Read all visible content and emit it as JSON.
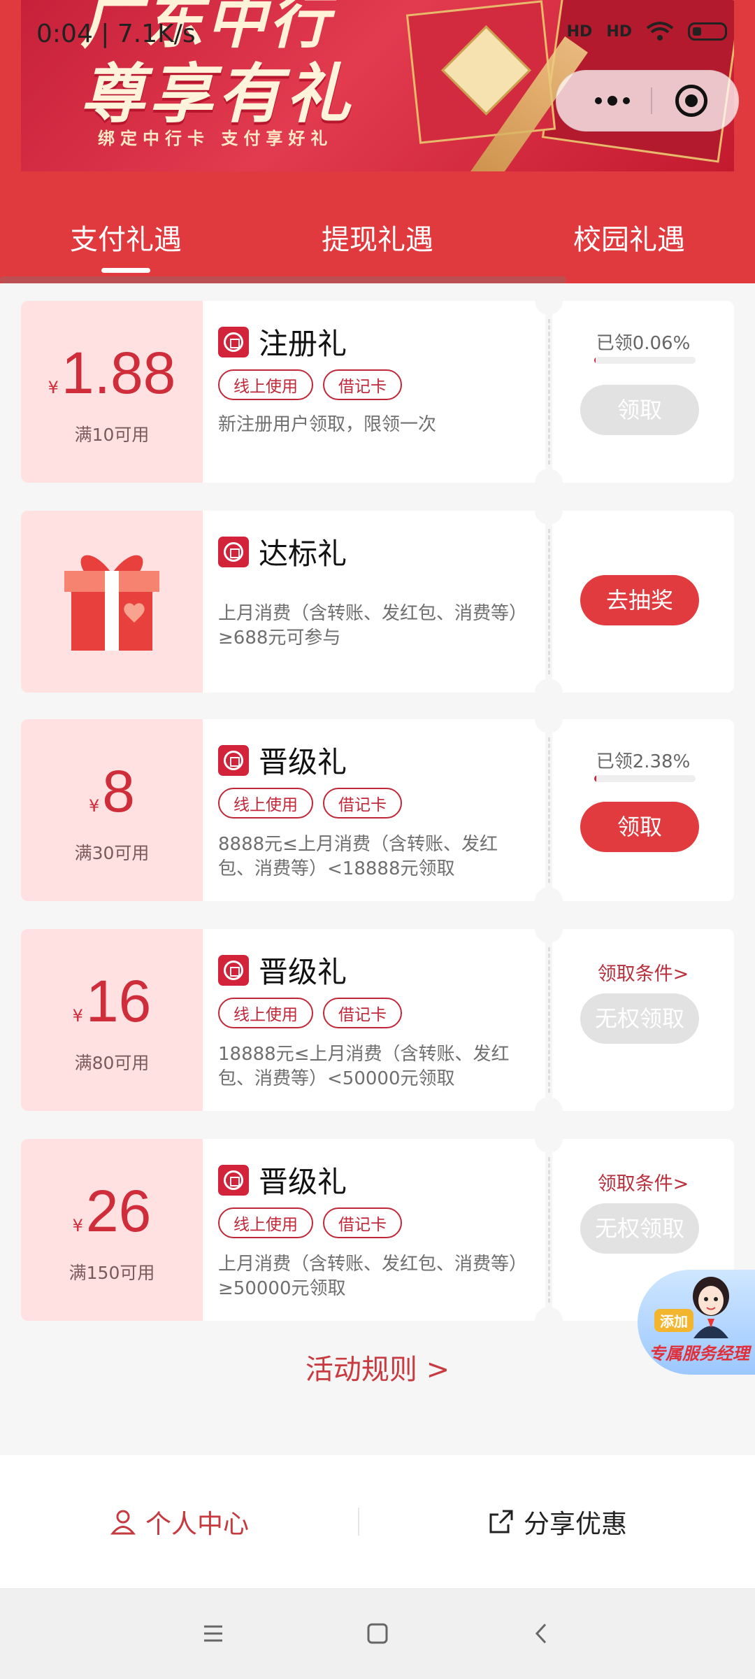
{
  "status_bar": {
    "time": "0:04 | 7.1K/s",
    "signal1": "HD",
    "signal2": "HD"
  },
  "banner": {
    "title_top": "广东中行",
    "title": "尊享有礼",
    "subtitle": "绑定中行卡  支付享好礼"
  },
  "tabs": [
    {
      "label": "支付礼遇",
      "active": true
    },
    {
      "label": "提现礼遇",
      "active": false
    },
    {
      "label": "校园礼遇",
      "active": false
    }
  ],
  "coupons": [
    {
      "currency": "¥",
      "amount": "1.88",
      "condition": "满10可用",
      "title": "注册礼",
      "tags": [
        "线上使用",
        "借记卡"
      ],
      "description": "新注册用户领取，限领一次",
      "claimed": "已领0.06%",
      "claimed_fraction": 0.0006,
      "button": "领取",
      "button_state": "disabled"
    },
    {
      "title": "达标礼",
      "description": "上月消费（含转账、发红包、消费等）≥688元可参与",
      "button": "去抽奖",
      "button_state": "active"
    },
    {
      "currency": "¥",
      "amount": "8",
      "condition": "满30可用",
      "title": "晋级礼",
      "tags": [
        "线上使用",
        "借记卡"
      ],
      "description": "8888元≤上月消费（含转账、发红包、消费等）<18888元领取",
      "claimed": "已领2.38%",
      "claimed_fraction": 0.0238,
      "button": "领取",
      "button_state": "active"
    },
    {
      "currency": "¥",
      "amount": "16",
      "condition": "满80可用",
      "title": "晋级礼",
      "tags": [
        "线上使用",
        "借记卡"
      ],
      "description": "18888元≤上月消费（含转账、发红包、消费等）<50000元领取",
      "condition_link": "领取条件>",
      "button": "无权领取",
      "button_state": "disabled"
    },
    {
      "currency": "¥",
      "amount": "26",
      "condition": "满150可用",
      "title": "晋级礼",
      "tags": [
        "线上使用",
        "借记卡"
      ],
      "description": "上月消费（含转账、发红包、消费等）≥50000元领取",
      "condition_link": "领取条件>",
      "button": "无权领取",
      "button_state": "disabled"
    }
  ],
  "rules_link": "活动规则 >",
  "service": {
    "badge": "添加",
    "label": "专属服务经理"
  },
  "actions": {
    "personal": "个人中心",
    "share": "分享优惠"
  },
  "colors": {
    "brand_red": "#e03a3e",
    "coupon_red": "#cf2d3a",
    "disabled_gray": "#e2e2e2"
  }
}
